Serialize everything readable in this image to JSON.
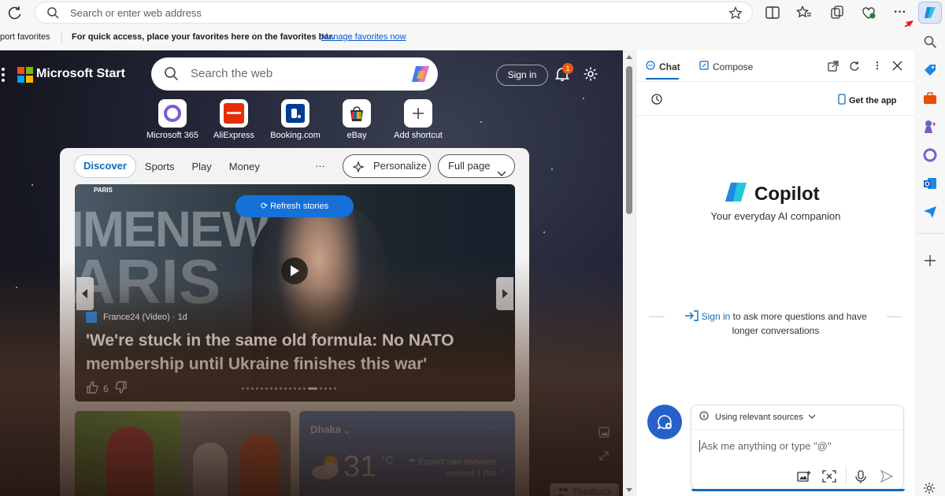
{
  "browser": {
    "address_placeholder": "Search or enter web address"
  },
  "favorites_bar": {
    "import_label": "port favorites",
    "message": "For quick access, place your favorites here on the favorites bar.",
    "manage_link": "Manage favorites now"
  },
  "start_page": {
    "brand": "Microsoft Start",
    "search_placeholder": "Search the web",
    "sign_in": "Sign in",
    "notification_count": "1",
    "shortcuts": [
      {
        "label": "Microsoft 365",
        "icon": "m365-icon"
      },
      {
        "label": "AliExpress",
        "icon": "aliexpress-icon"
      },
      {
        "label": "Booking.com",
        "icon": "booking-icon"
      },
      {
        "label": "eBay",
        "icon": "ebay-icon"
      },
      {
        "label": "Add shortcut",
        "icon": "plus-icon"
      }
    ],
    "feed_tabs": [
      "Discover",
      "Sports",
      "Play",
      "Money"
    ],
    "more": "···",
    "personalize": "Personalize",
    "full_page": "Full page",
    "hero": {
      "place": "PARIS",
      "refresh": "Refresh stories",
      "bg_text_1": "IMENEW",
      "bg_text_2": "ARIS",
      "source": "France24 (Video) · 1d",
      "headline": "'We're stuck in the same old formula: No NATO membership until Ukraine finishes this war'",
      "likes": "6"
    },
    "weather": {
      "city": "Dhaka",
      "more": "···",
      "temp": "31",
      "unit": "°C",
      "forecast_line1": "Expect rain showers",
      "forecast_line2": "around 3 PM"
    },
    "feedback": "Feedback"
  },
  "copilot": {
    "tab_chat": "Chat",
    "tab_compose": "Compose",
    "get_app": "Get the app",
    "brand": "Copilot",
    "subtitle": "Your everyday AI companion",
    "signin_link": "Sign in",
    "signin_rest_1": "to ask more questions and have",
    "signin_rest_2": "longer conversations",
    "sources": "Using relevant sources",
    "input_placeholder": "Ask me anything or type \"@\""
  },
  "colors": {
    "accent": "#0f6cbd",
    "copilot_blue": "#2661c9",
    "annotation_red": "#e02020"
  }
}
